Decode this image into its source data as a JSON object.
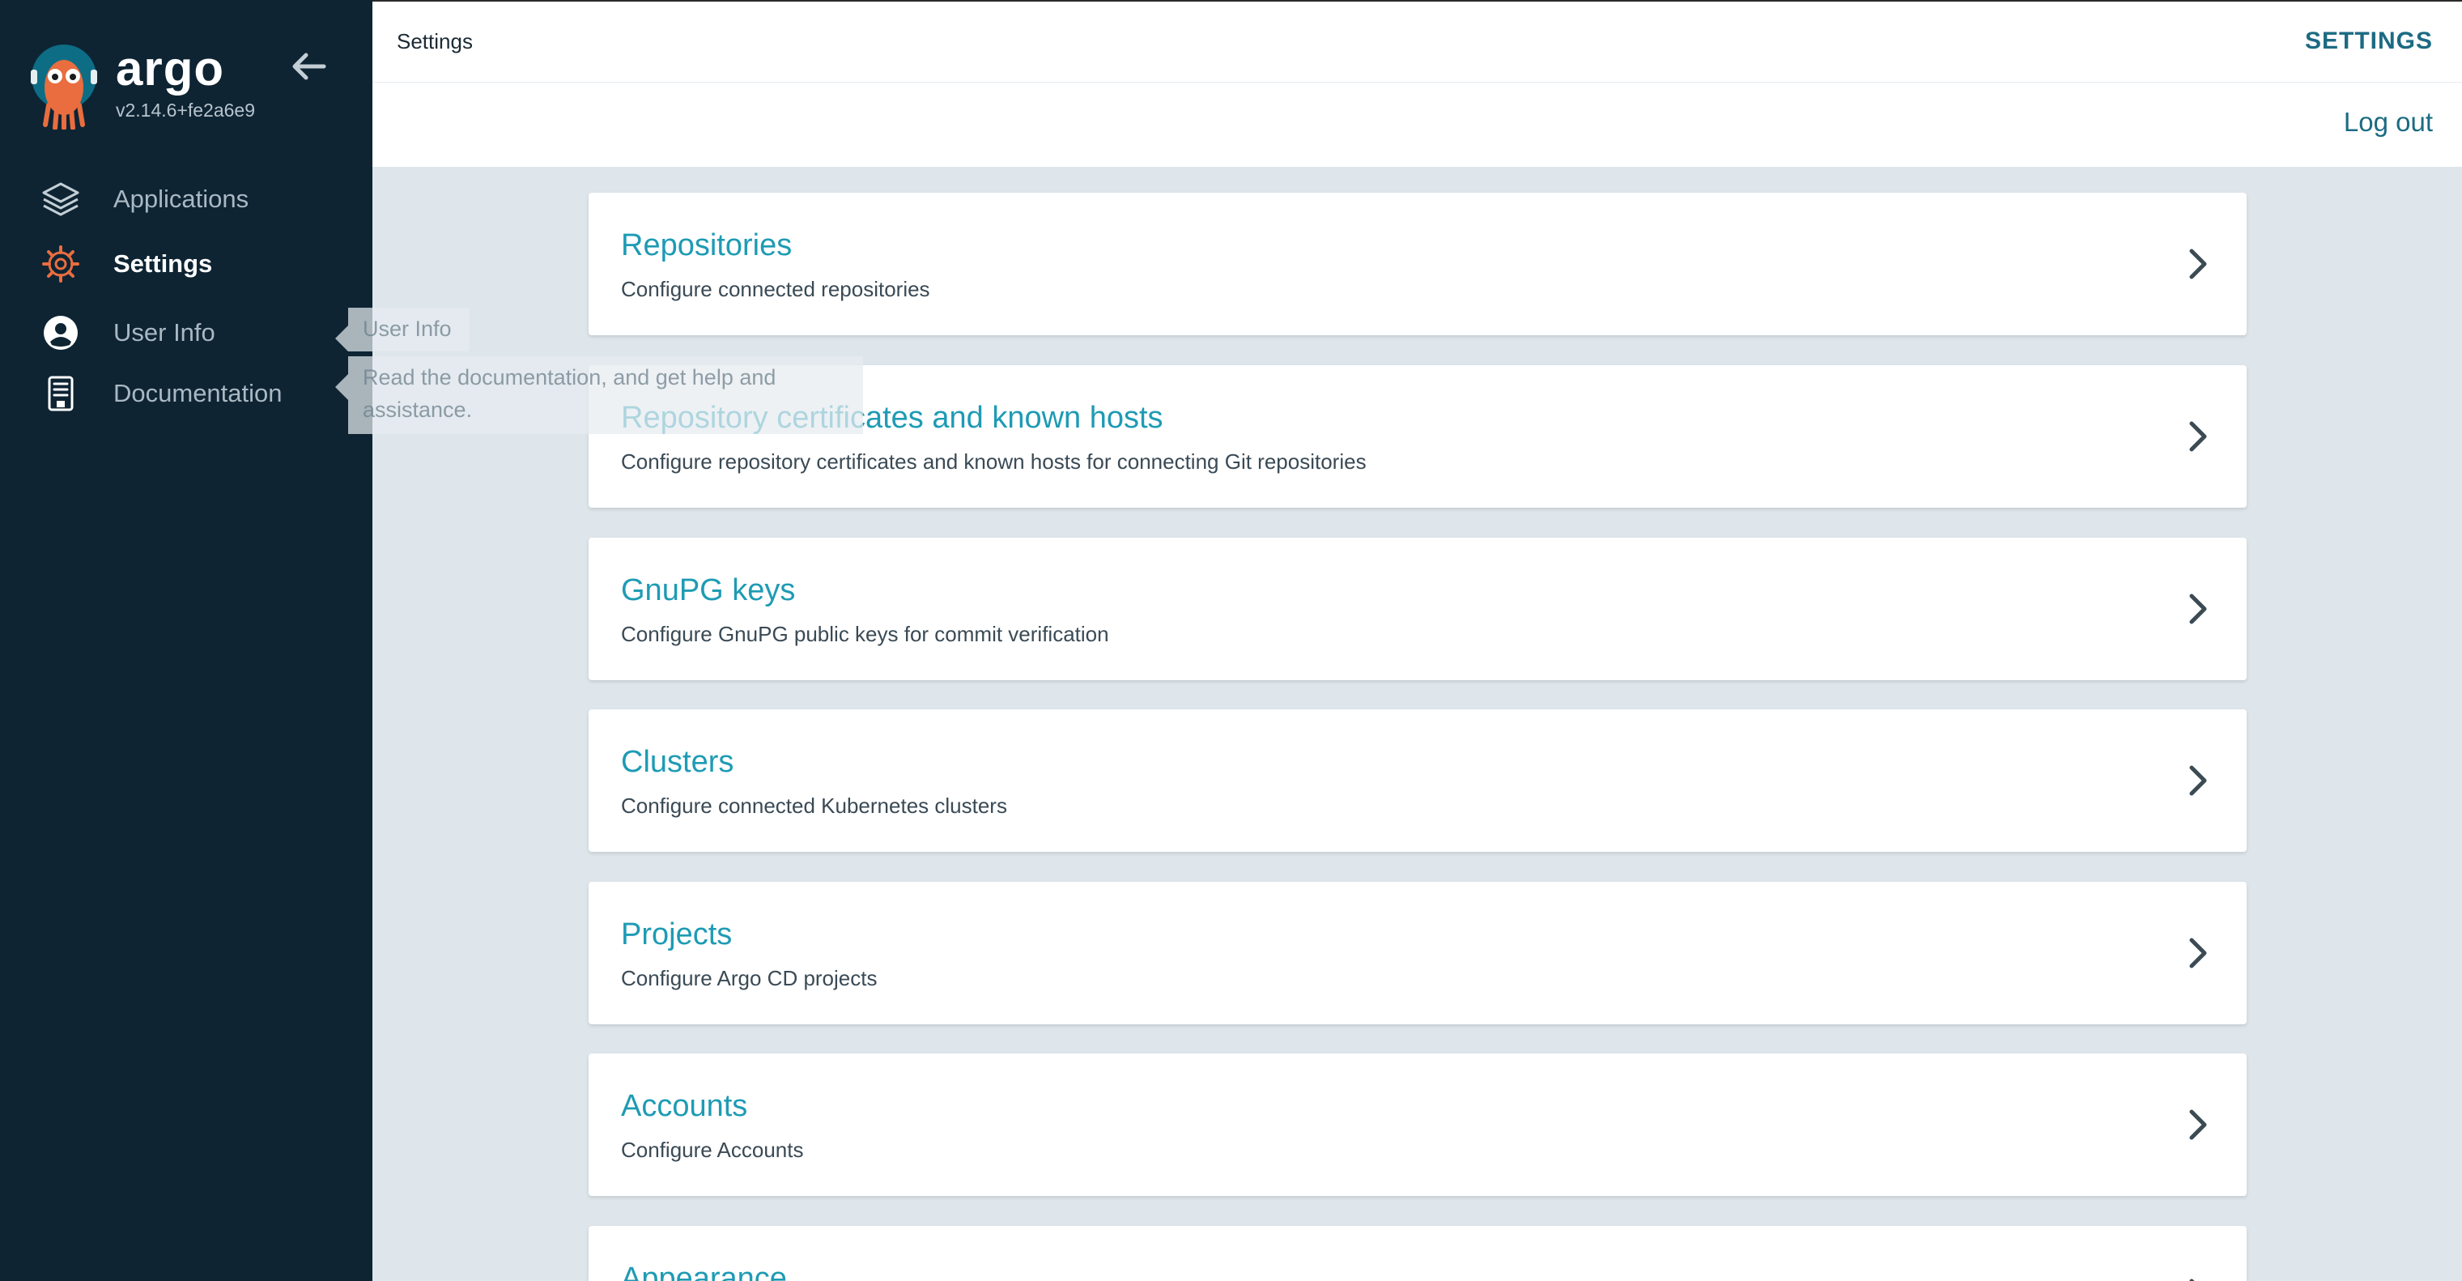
{
  "sidebar": {
    "brand": "argo",
    "version": "v2.14.6+fe2a6e9",
    "items": [
      {
        "label": "Applications",
        "icon": "layers-icon"
      },
      {
        "label": "Settings",
        "icon": "gear-icon"
      },
      {
        "label": "User Info",
        "icon": "user-circle-icon"
      },
      {
        "label": "Documentation",
        "icon": "book-icon"
      }
    ]
  },
  "tooltips": {
    "user_info": "User Info",
    "documentation": "Read the documentation, and get help and assistance."
  },
  "header": {
    "breadcrumb": "Settings",
    "title": "SETTINGS",
    "logout": "Log out"
  },
  "cards": [
    {
      "title": "Repositories",
      "description": "Configure connected repositories"
    },
    {
      "title": "Repository certificates and known hosts",
      "description": "Configure repository certificates and known hosts for connecting Git repositories"
    },
    {
      "title": "GnuPG keys",
      "description": "Configure GnuPG public keys for commit verification"
    },
    {
      "title": "Clusters",
      "description": "Configure connected Kubernetes clusters"
    },
    {
      "title": "Projects",
      "description": "Configure Argo CD projects"
    },
    {
      "title": "Accounts",
      "description": "Configure Accounts"
    },
    {
      "title": "Appearance",
      "description": ""
    }
  ],
  "colors": {
    "sidebar_bg": "#0e2433",
    "accent": "#1e9bb4",
    "header_accent": "#1c6b82",
    "page_bg": "#dee6eb",
    "logo_orange": "#e96d3f"
  }
}
